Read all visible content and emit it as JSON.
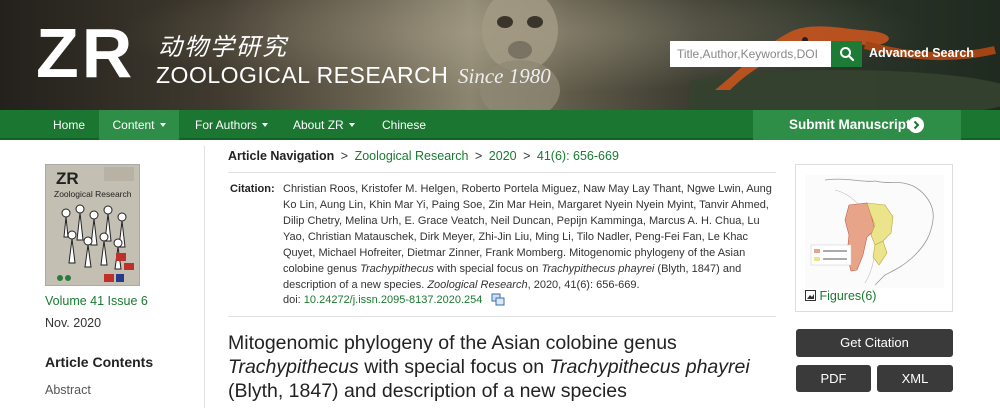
{
  "header": {
    "logo_zr": "ZR",
    "logo_chinese": "动物学研究",
    "logo_english": "ZOOLOGICAL RESEARCH",
    "since": "Since 1980",
    "search_placeholder": "Title,Author,Keywords,DOI",
    "search_icon": "search-icon",
    "advanced_search": "Advanced Search"
  },
  "nav": {
    "items": [
      {
        "label": "Home",
        "dropdown": false
      },
      {
        "label": "Content",
        "dropdown": true,
        "active": true
      },
      {
        "label": "For Authors",
        "dropdown": true
      },
      {
        "label": "About ZR",
        "dropdown": true
      },
      {
        "label": "Chinese",
        "dropdown": false
      }
    ],
    "submit_label": "Submit Manuscript",
    "submit_icon": "chevron-right-circle-icon"
  },
  "sidebar_left": {
    "cover_title": "ZR",
    "cover_subtitle": "Zoological Research",
    "volume_issue": "Volume 41 Issue 6",
    "date": "Nov.  2020",
    "contents_heading": "Article Contents",
    "contents_items": [
      "Abstract"
    ]
  },
  "breadcrumb": {
    "label": "Article Navigation",
    "items": [
      "Zoological Research",
      "2020",
      "41(6): 656-669"
    ]
  },
  "citation": {
    "label": "Citation:",
    "authors": "Christian Roos, Kristofer M. Helgen, Roberto Portela Miguez, Naw May Lay Thant, Ngwe Lwin, Aung Ko Lin, Aung Lin, Khin Mar Yi, Paing Soe, Zin Mar Hein, Margaret Nyein Nyein Myint, Tanvir Ahmed, Dilip Chetry, Melina Urh, E. Grace Veatch, Neil Duncan, Pepijn Kamminga, Marcus A. H. Chua, Lu Yao, Christian Matauschek, Dirk Meyer, Zhi-Jin Liu, Ming Li, Tilo Nadler, Peng-Fei Fan, Le Khac Quyet, Michael Hofreiter, Dietmar Zinner, Frank Momberg.",
    "title_part1": "Mitogenomic phylogeny of the Asian colobine genus ",
    "genus": "Trachypithecus",
    "title_part2": " with special focus on ",
    "species": "Trachypithecus phayrei",
    "title_part3": " (Blyth, 1847) and description of a new species. ",
    "journal": "Zoological Research",
    "volume_info": ", 2020, 41(6): 656-669.",
    "doi_label": "doi: ",
    "doi": "10.24272/j.issn.2095-8137.2020.254"
  },
  "article": {
    "title_part1": "Mitogenomic phylogeny of the Asian colobine genus ",
    "title_italic1": "Trachypithecus",
    "title_part2": " with special focus on ",
    "title_italic2": "Trachypithecus phayrei",
    "title_part3": " (Blyth, 1847) and description of a new species"
  },
  "sidebar_right": {
    "figures_link": "Figures(6)",
    "get_citation": "Get Citation",
    "pdf": "PDF",
    "xml": "XML"
  },
  "colors": {
    "brand_green": "#1a7630",
    "link_green": "#1a7a30",
    "dark_button": "#3a3a3a"
  }
}
